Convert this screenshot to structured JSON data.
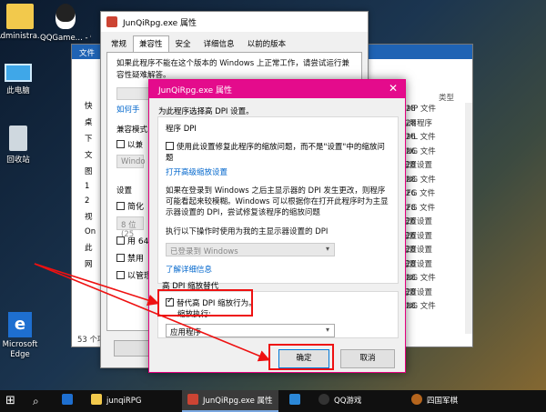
{
  "desktop": {
    "icons": [
      {
        "label": "Administra...",
        "icon": "user-folder-icon"
      },
      {
        "label": "QQGame... - 快捷方式",
        "icon": "qq-penguin-icon"
      },
      {
        "label": "此电脑",
        "icon": "this-pc-icon"
      },
      {
        "label": "回收站",
        "icon": "recycle-bin-icon"
      },
      {
        "label": "Microsoft Edge",
        "icon": "edge-icon"
      }
    ]
  },
  "explorer": {
    "ribbon_tab": "文件",
    "nav": [
      "快",
      "桌",
      "下",
      "文",
      "图",
      "1",
      "2",
      "视",
      "On",
      "此",
      "网"
    ],
    "type_header": "类型",
    "nums": [
      "28",
      "28",
      "26",
      "26",
      "28",
      "28",
      "26",
      "28",
      "26",
      "26",
      "28",
      "28",
      "28",
      "28",
      "28"
    ],
    "types": [
      "BMP 文件",
      "应用程序",
      "XML 文件",
      "PNG 文件",
      "配置设置",
      "PNG 文件",
      "CFG 文件",
      "CFG 文件",
      "配置设置",
      "配置设置",
      "配置设置",
      "配置设置",
      "PNG 文件",
      "配置设置",
      "PNG 文件"
    ],
    "status": "53 个项目"
  },
  "props": {
    "title": "JunQiRpg.exe 属性",
    "tabs": [
      "常规",
      "兼容性",
      "安全",
      "详细信息",
      "以前的版本"
    ],
    "intro": "如果此程序不能在这个版本的 Windows 上正常工作，请尝试运行兼容性疑难解答。",
    "link_partial": "如何手",
    "section_compat": "兼容模式",
    "compat_chk": "以兼",
    "compat_select": "Windo",
    "section_settings": "设置",
    "settings": [
      "简化",
      "8 位(25",
      "用 64",
      "禁用",
      "以管理"
    ]
  },
  "dpi": {
    "title": "JunQiRpg.exe 属性",
    "intro": "为此程序选择高 DPI 设置。",
    "section1": "程序 DPI",
    "chk1": "使用此设置修复此程序的缩放问题，而不是\"设置\"中的缩放问题",
    "link1": "打开高级缩放设置",
    "para": "如果在登录到 Windows 之后主显示器的 DPI 发生更改，则程序可能看起来较模糊。Windows 可以根据你在打开此程序时为主显示器设置的 DPI，尝试修复该程序的缩放问题",
    "select_label": "执行以下操作时使用为我的主显示器设置的 DPI",
    "select1": "已登录到 Windows",
    "link2": "了解详细信息",
    "section2": "高 DPI 缩放替代",
    "chk2": "替代高 DPI 缩放行为。",
    "chk2b": "缩放执行:",
    "select2": "应用程序",
    "ok": "确定",
    "cancel": "取消"
  },
  "taskbar": {
    "items": [
      "junqiRPG",
      "JunQiRpg.exe 属性",
      "QQ游戏",
      "四国军棋"
    ]
  },
  "colors": {
    "accent": "#e40b8c",
    "annotation": "#e11111"
  }
}
